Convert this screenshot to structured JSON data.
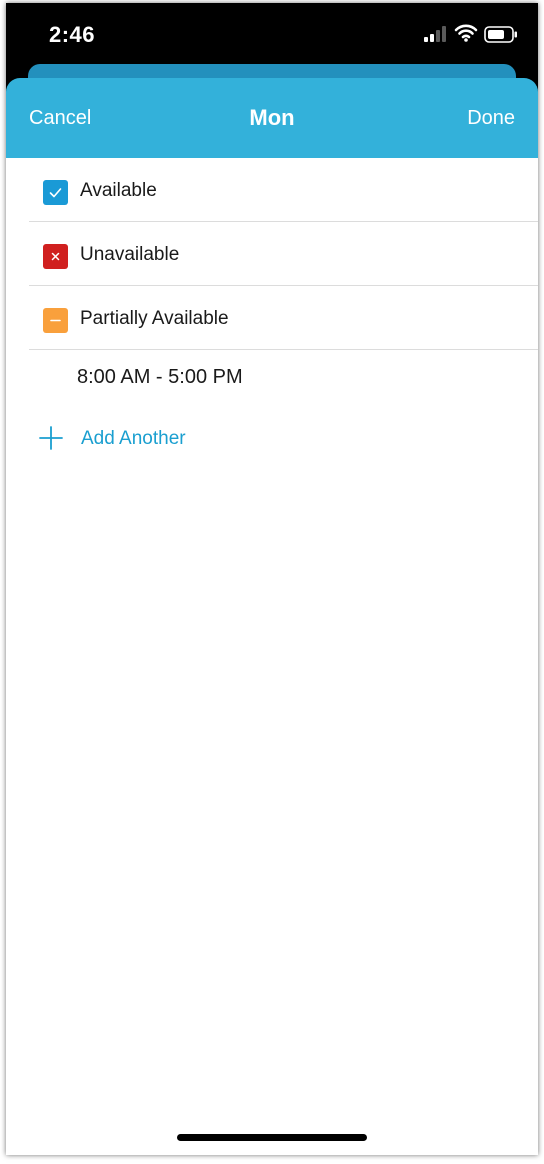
{
  "status_bar": {
    "time": "2:46",
    "signal_icon": "cellular-signal-icon",
    "wifi_icon": "wifi-icon",
    "battery_icon": "battery-icon"
  },
  "header": {
    "title": "Mon",
    "cancel_label": "Cancel",
    "done_label": "Done"
  },
  "options": [
    {
      "label": "Available",
      "icon": "checkmark-icon",
      "color": "#1a9ad6"
    },
    {
      "label": "Unavailable",
      "icon": "x-icon",
      "color": "#d0201f"
    },
    {
      "label": "Partially Available",
      "icon": "minus-icon",
      "color": "#f9a03c"
    }
  ],
  "time_slots": [
    "8:00 AM - 5:00 PM"
  ],
  "add_another": {
    "label": "Add Another",
    "icon": "plus-icon"
  },
  "colors": {
    "header_background": "#33b1da",
    "accent": "#1a9fd0"
  }
}
